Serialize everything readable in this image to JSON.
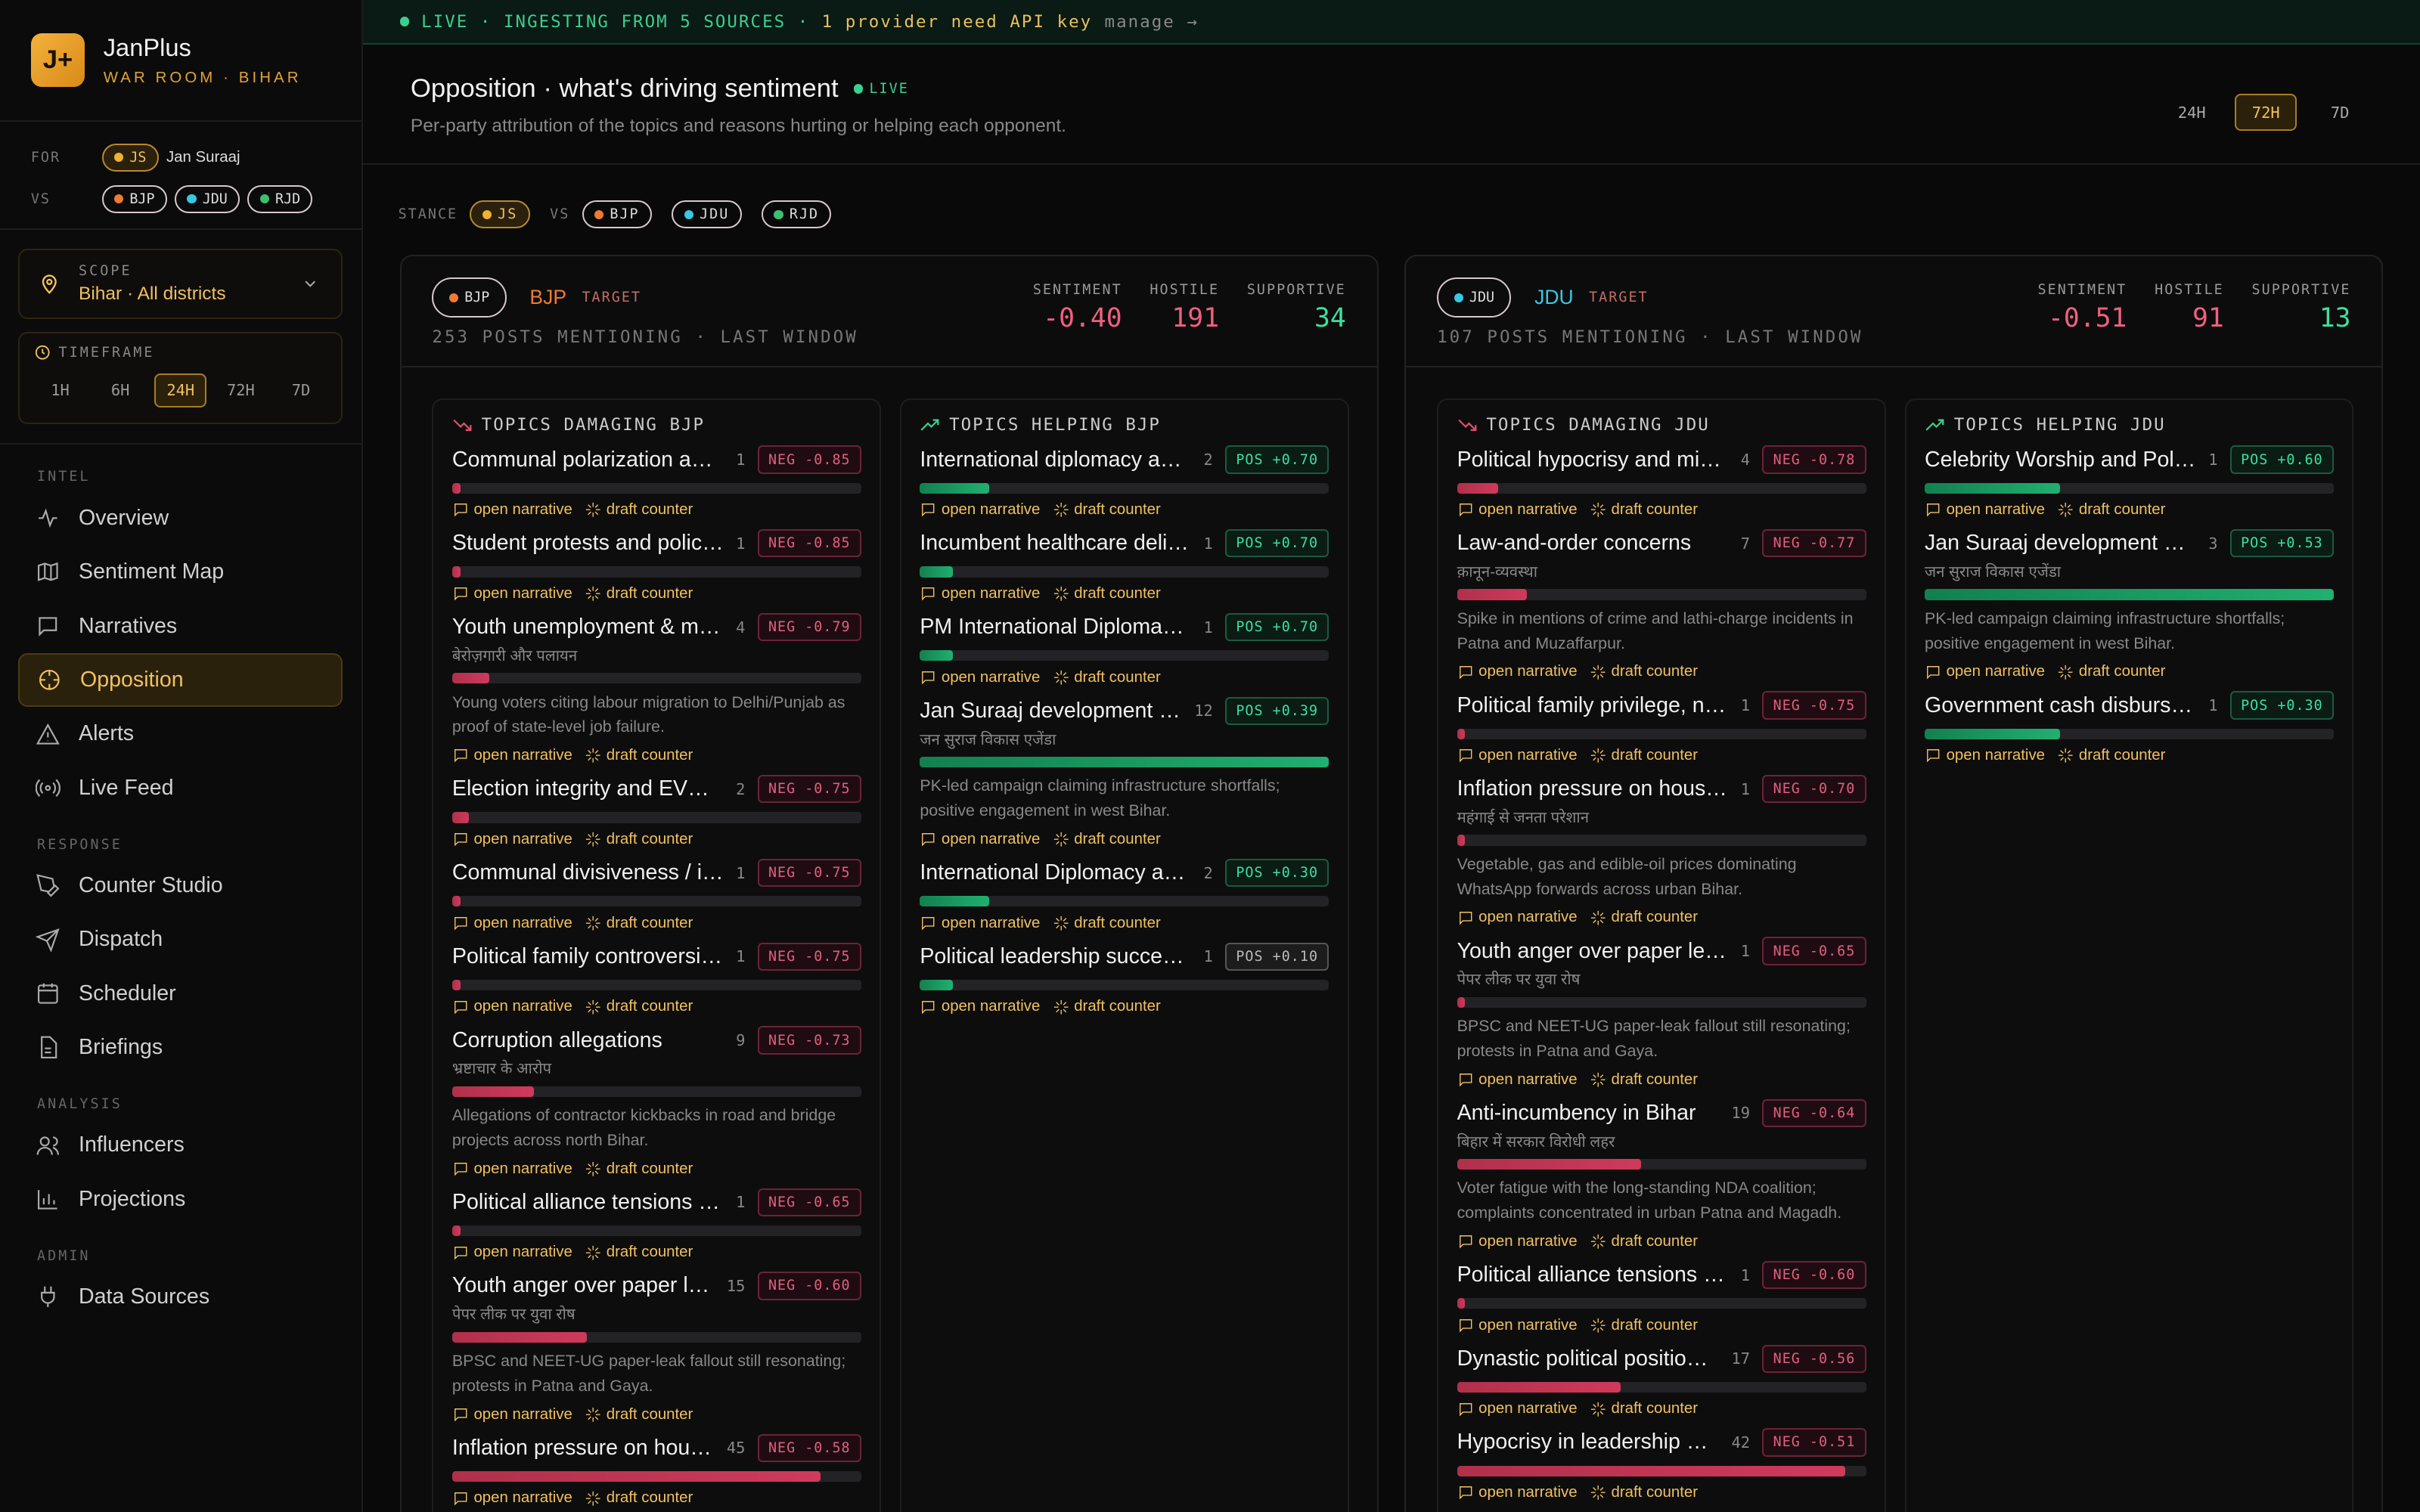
{
  "brand": {
    "logo": "J+",
    "name": "JanPlus",
    "sub": "WAR ROOM · BIHAR"
  },
  "forvs": {
    "for_label": "FOR",
    "for_party": "JS",
    "for_name": "Jan Suraaj",
    "vs_label": "VS",
    "vs_parties": [
      "BJP",
      "JDU",
      "RJD"
    ]
  },
  "scope": {
    "label": "SCOPE",
    "value": "Bihar · All districts"
  },
  "timeframe": {
    "label": "TIMEFRAME",
    "options": [
      "1H",
      "6H",
      "24H",
      "72H",
      "7D"
    ],
    "active": "24H"
  },
  "nav": {
    "intel_label": "INTEL",
    "intel": [
      "Overview",
      "Sentiment Map",
      "Narratives",
      "Opposition",
      "Alerts",
      "Live Feed"
    ],
    "response_label": "RESPONSE",
    "response": [
      "Counter Studio",
      "Dispatch",
      "Scheduler",
      "Briefings"
    ],
    "analysis_label": "ANALYSIS",
    "analysis": [
      "Influencers",
      "Projections"
    ],
    "admin_label": "ADMIN",
    "admin": [
      "Data Sources"
    ],
    "active": "Opposition"
  },
  "banner": {
    "live": "LIVE · INGESTING FROM 5 SOURCES ·",
    "warn": "1 provider need API key",
    "manage": "manage →"
  },
  "header": {
    "title": "Opposition · what's driving sentiment",
    "live": "LIVE",
    "subtitle": "Per-party attribution of the topics and reasons hurting or helping each opponent.",
    "ranges": [
      "24H",
      "72H",
      "7D"
    ],
    "active_range": "72H"
  },
  "stance": {
    "label": "STANCE",
    "for": "JS",
    "vs": "VS",
    "parties": [
      "BJP",
      "JDU",
      "RJD"
    ]
  },
  "actions": {
    "open": "open narrative",
    "draft": "draft counter"
  },
  "panels": [
    {
      "party": "BJP",
      "color": "#f07a30",
      "target": "TARGET",
      "posts": "253 POSTS MENTIONING · LAST WINDOW",
      "stats": {
        "sentiment_label": "SENTIMENT",
        "sentiment": "-0.40",
        "hostile_label": "HOSTILE",
        "hostile": "191",
        "supportive_label": "SUPPORTIVE",
        "supportive": "34"
      },
      "damaging_label": "TOPICS DAMAGING BJP",
      "helping_label": "TOPICS HELPING BJP",
      "damaging": [
        {
          "title": "Communal polarization and…",
          "count": "1",
          "badge": "NEG -0.85",
          "fill": 0.02
        },
        {
          "title": "Student protests and police…",
          "count": "1",
          "badge": "NEG -0.85",
          "fill": 0.02
        },
        {
          "title": "Youth unemployment & mig…",
          "count": "4",
          "badge": "NEG -0.79",
          "fill": 0.09,
          "sub": "बेरोज़गारी और पलायन",
          "desc": "Young voters citing labour migration to Delhi/Punjab as proof of state-level job failure."
        },
        {
          "title": "Election integrity and EVM/…",
          "count": "2",
          "badge": "NEG -0.75",
          "fill": 0.04
        },
        {
          "title": "Communal divisiveness / i…",
          "count": "1",
          "badge": "NEG -0.75",
          "fill": 0.02
        },
        {
          "title": "Political family controversie…",
          "count": "1",
          "badge": "NEG -0.75",
          "fill": 0.02
        },
        {
          "title": "Corruption allegations",
          "count": "9",
          "badge": "NEG -0.73",
          "fill": 0.2,
          "sub": "भ्रष्टाचार के आरोप",
          "desc": "Allegations of contractor kickbacks in road and bridge projects across north Bihar."
        },
        {
          "title": "Political alliance tensions a…",
          "count": "1",
          "badge": "NEG -0.65",
          "fill": 0.02
        },
        {
          "title": "Youth anger over paper leaks",
          "count": "15",
          "badge": "NEG -0.60",
          "fill": 0.33,
          "sub": "पेपर लीक पर युवा रोष",
          "desc": "BPSC and NEET-UG paper-leak fallout still resonating; protests in Patna and Gaya."
        },
        {
          "title": "Inflation pressure on hous…",
          "count": "45",
          "badge": "NEG -0.58",
          "fill": 0.9
        }
      ],
      "helping": [
        {
          "title": "International diplomacy and…",
          "count": "2",
          "badge": "POS +0.70",
          "fill": 0.17,
          "kind": "pos"
        },
        {
          "title": "Incumbent healthcare deliv…",
          "count": "1",
          "badge": "POS +0.70",
          "fill": 0.08,
          "kind": "pos"
        },
        {
          "title": "PM International Diplomacy…",
          "count": "1",
          "badge": "POS +0.70",
          "fill": 0.08,
          "kind": "pos"
        },
        {
          "title": "Jan Suraaj development pl…",
          "count": "12",
          "badge": "POS +0.39",
          "fill": 1.0,
          "kind": "pos",
          "sub": "जन सुराज विकास एजेंडा",
          "desc": "PK-led campaign claiming infrastructure shortfalls; positive engagement in west Bihar."
        },
        {
          "title": "International Diplomacy an…",
          "count": "2",
          "badge": "POS +0.30",
          "fill": 0.17,
          "kind": "pos"
        },
        {
          "title": "Political leadership success…",
          "count": "1",
          "badge": "POS +0.10",
          "fill": 0.08,
          "kind": "neu"
        }
      ]
    },
    {
      "party": "JDU",
      "color": "#38c8e0",
      "target": "TARGET",
      "posts": "107 POSTS MENTIONING · LAST WINDOW",
      "stats": {
        "sentiment_label": "SENTIMENT",
        "sentiment": "-0.51",
        "hostile_label": "HOSTILE",
        "hostile": "91",
        "supportive_label": "SUPPORTIVE",
        "supportive": "13"
      },
      "damaging_label": "TOPICS DAMAGING JDU",
      "helping_label": "TOPICS HELPING JDU",
      "damaging": [
        {
          "title": "Political hypocrisy and misu…",
          "count": "4",
          "badge": "NEG -0.78",
          "fill": 0.1
        },
        {
          "title": "Law-and-order concerns",
          "count": "7",
          "badge": "NEG -0.77",
          "fill": 0.17,
          "sub": "क़ानून-व्यवस्था",
          "desc": "Spike in mentions of crime and lathi-charge incidents in Patna and Muzaffarpur."
        },
        {
          "title": "Political family privilege, ne…",
          "count": "1",
          "badge": "NEG -0.75",
          "fill": 0.02
        },
        {
          "title": "Inflation pressure on house…",
          "count": "1",
          "badge": "NEG -0.70",
          "fill": 0.02,
          "sub": "महंगाई से जनता परेशान",
          "desc": "Vegetable, gas and edible-oil prices dominating WhatsApp forwards across urban Bihar."
        },
        {
          "title": "Youth anger over paper leaks",
          "count": "1",
          "badge": "NEG -0.65",
          "fill": 0.02,
          "sub": "पेपर लीक पर युवा रोष",
          "desc": "BPSC and NEET-UG paper-leak fallout still resonating; protests in Patna and Gaya."
        },
        {
          "title": "Anti-incumbency in Bihar",
          "count": "19",
          "badge": "NEG -0.64",
          "fill": 0.45,
          "sub": "बिहार में सरकार विरोधी लहर",
          "desc": "Voter fatigue with the long-standing NDA coalition; complaints concentrated in urban Patna and Magadh."
        },
        {
          "title": "Political alliance tensions a…",
          "count": "1",
          "badge": "NEG -0.60",
          "fill": 0.02
        },
        {
          "title": "Dynastic political positioni…",
          "count": "17",
          "badge": "NEG -0.56",
          "fill": 0.4
        },
        {
          "title": "Hypocrisy in leadership — …",
          "count": "42",
          "badge": "NEG -0.51",
          "fill": 0.95
        }
      ],
      "helping": [
        {
          "title": "Celebrity Worship and Politi…",
          "count": "1",
          "badge": "POS +0.60",
          "fill": 0.33,
          "kind": "pos"
        },
        {
          "title": "Jan Suraaj development plank",
          "count": "3",
          "badge": "POS +0.53",
          "fill": 1.0,
          "kind": "pos",
          "sub": "जन सुराज विकास एजेंडा",
          "desc": "PK-led campaign claiming infrastructure shortfalls; positive engagement in west Bihar."
        },
        {
          "title": "Government cash disburse…",
          "count": "1",
          "badge": "POS +0.30",
          "fill": 0.33,
          "kind": "pos"
        }
      ]
    }
  ]
}
